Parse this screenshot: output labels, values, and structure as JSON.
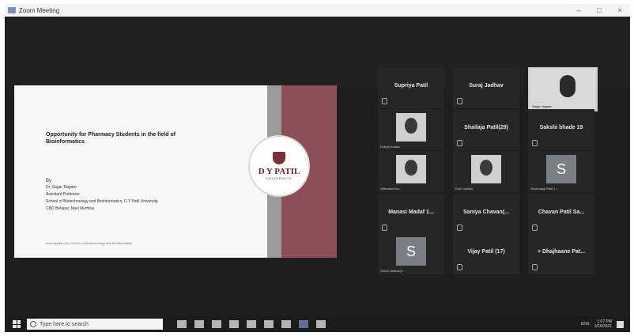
{
  "window": {
    "title": "Zoom Meeting",
    "controls": [
      "–",
      "□",
      "×"
    ]
  },
  "slide": {
    "title": "Opportunity for Pharmacy Students in the field of Bioinformatics",
    "by": "By",
    "lines": [
      "Dr. Sagar Nagare",
      "Assistant Professor",
      "School of Biotechnology and Bioinformatics, D Y Patil University,",
      "CBD Belapur, Navi Mumbai"
    ],
    "footer": "www.dypatil.edu  |  School of Biotechnology and Bioinformatics",
    "logo_name": "D Y PATIL",
    "logo_sub": "UNIVERSITY"
  },
  "participants": [
    {
      "name": "Supriya Patil",
      "kind": "name"
    },
    {
      "name": "Suraj Jadhav",
      "kind": "name"
    },
    {
      "name": "",
      "kind": "video",
      "caption": "Sagar Nagare"
    },
    {
      "name": "",
      "kind": "photo",
      "caption": "Rutuja Kadam"
    },
    {
      "name": "Shailaja Patil(29)",
      "kind": "name"
    },
    {
      "name": "Sakshi bhade 19",
      "kind": "name"
    },
    {
      "name": "",
      "kind": "photo",
      "caption": "Vaishnavi bor..."
    },
    {
      "name": "",
      "kind": "photo",
      "caption": "Rani Jadhav"
    },
    {
      "name": "",
      "kind": "avatar",
      "letter": "S",
      "caption": "Shubhangi Patil 1..."
    },
    {
      "name": "Manasi Madaf 1...",
      "kind": "name"
    },
    {
      "name": "Saniya Chavan(...",
      "kind": "name"
    },
    {
      "name": "Chavan Patil Sa...",
      "kind": "name"
    },
    {
      "name": "",
      "kind": "avatar",
      "letter": "S",
      "caption": "Shruti Jadhav(3..."
    },
    {
      "name": "Vijay Patil (17)",
      "kind": "name"
    },
    {
      "name": "+ Dhajhaane Pat...",
      "kind": "name"
    }
  ],
  "taskbar": {
    "search_placeholder": "Type here to search",
    "time": "1:07 PM",
    "date": "1/29/2021",
    "lang": "ENG"
  }
}
